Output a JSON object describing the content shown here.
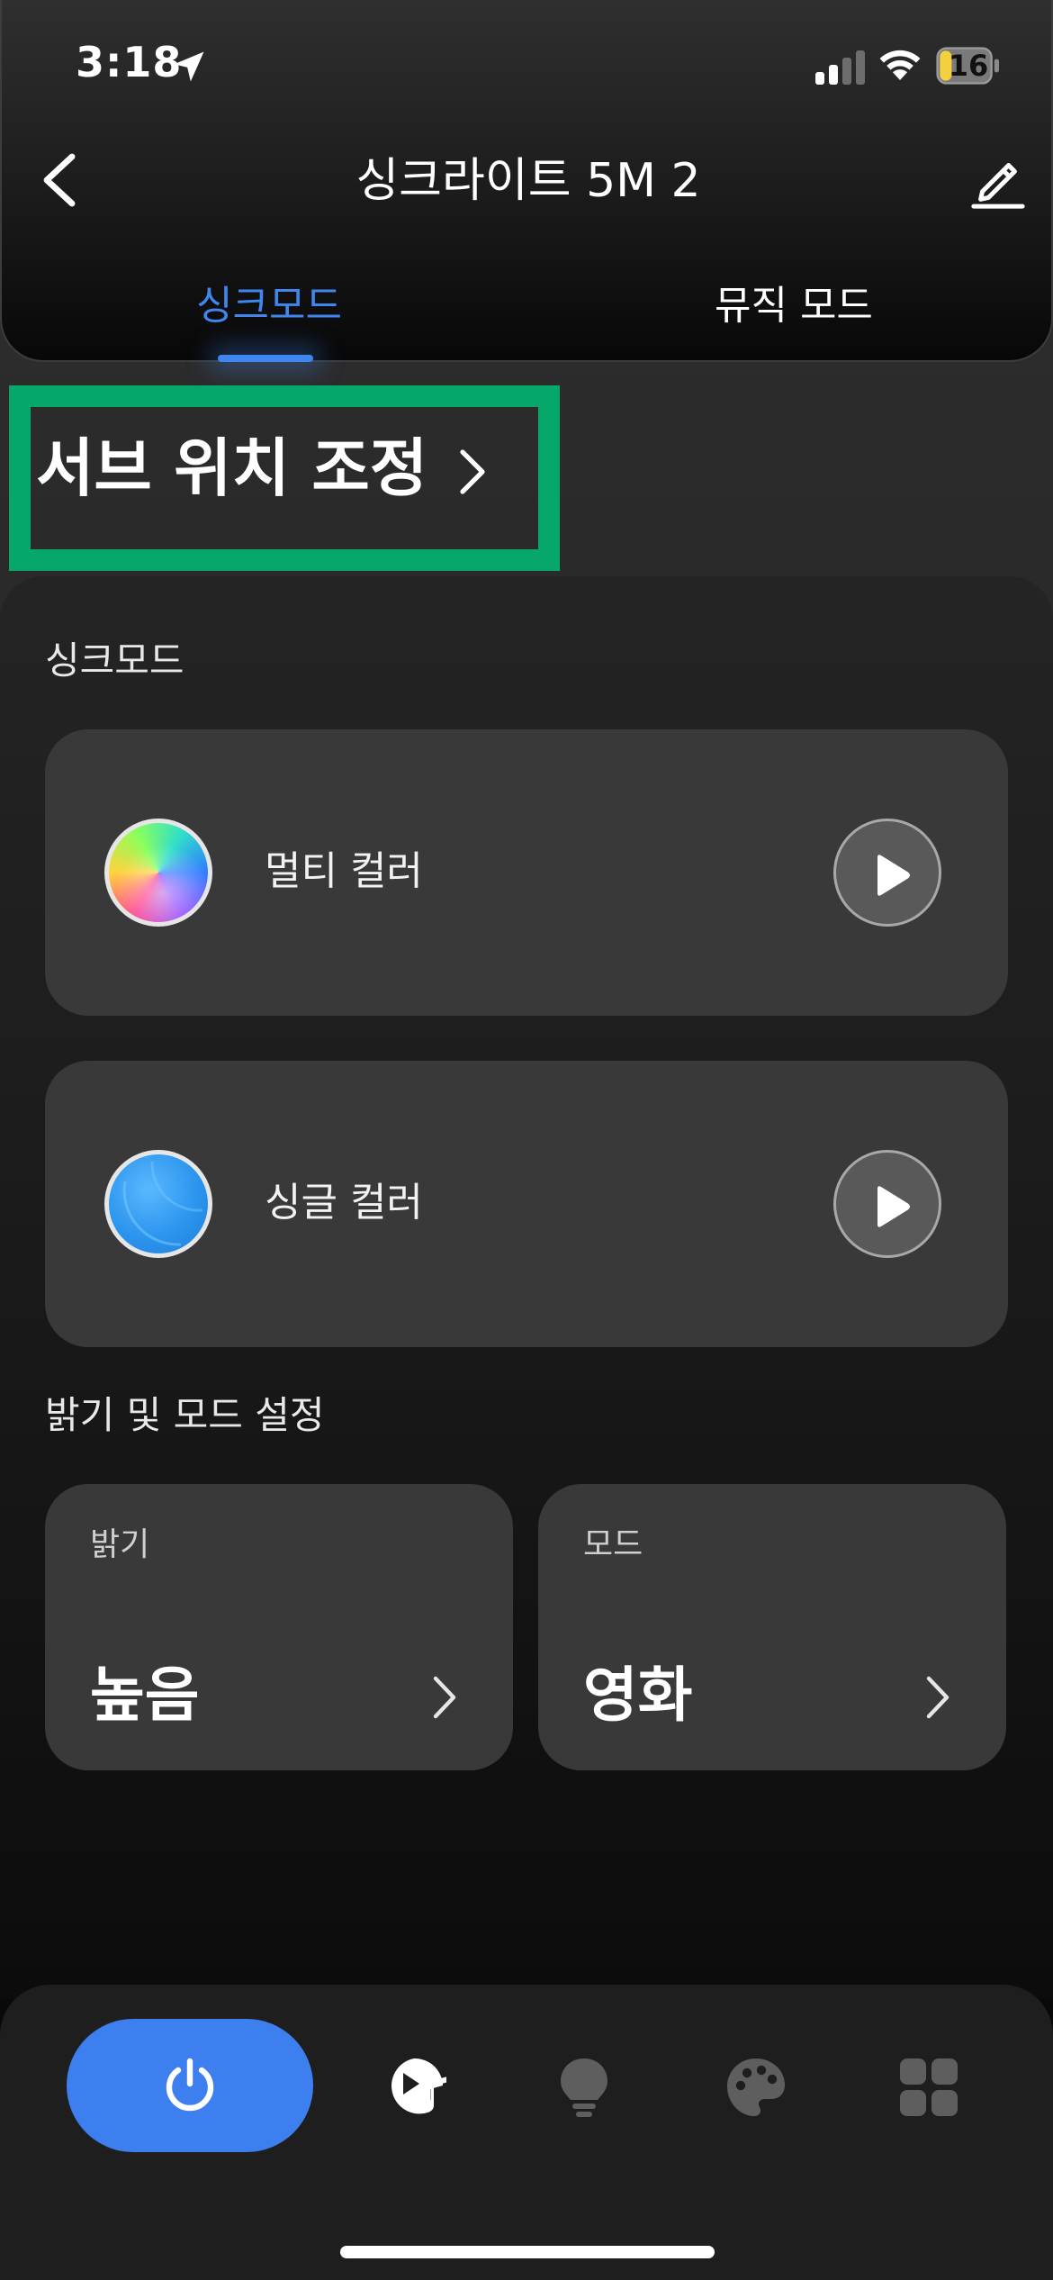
{
  "status_bar": {
    "time": "3:18",
    "battery": "16"
  },
  "header": {
    "title": "싱크라이트 5M 2"
  },
  "tabs": [
    {
      "label": "싱크모드",
      "active": true
    },
    {
      "label": "뮤직 모드",
      "active": false
    }
  ],
  "position_adjust": {
    "label": "서브 위치 조정"
  },
  "sync_section": {
    "title": "싱크모드",
    "modes": [
      {
        "label": "멀티 컬러",
        "swatch": "multi-color-swatch"
      },
      {
        "label": "싱글 컬러",
        "swatch": "single-color-swatch"
      }
    ]
  },
  "settings_section": {
    "title": "밝기 및 모드 설정",
    "brightness": {
      "label": "밝기",
      "value": "높음"
    },
    "mode": {
      "label": "모드",
      "value": "영화"
    }
  },
  "bottom_nav": {
    "items": [
      "power-icon",
      "music-sync-icon",
      "bulb-icon",
      "palette-icon",
      "grid-apps-icon"
    ],
    "active_color": "#3e7ff0"
  },
  "colors": {
    "accent": "#3f86ef",
    "highlight": "#07a66a",
    "card": "#393939"
  }
}
